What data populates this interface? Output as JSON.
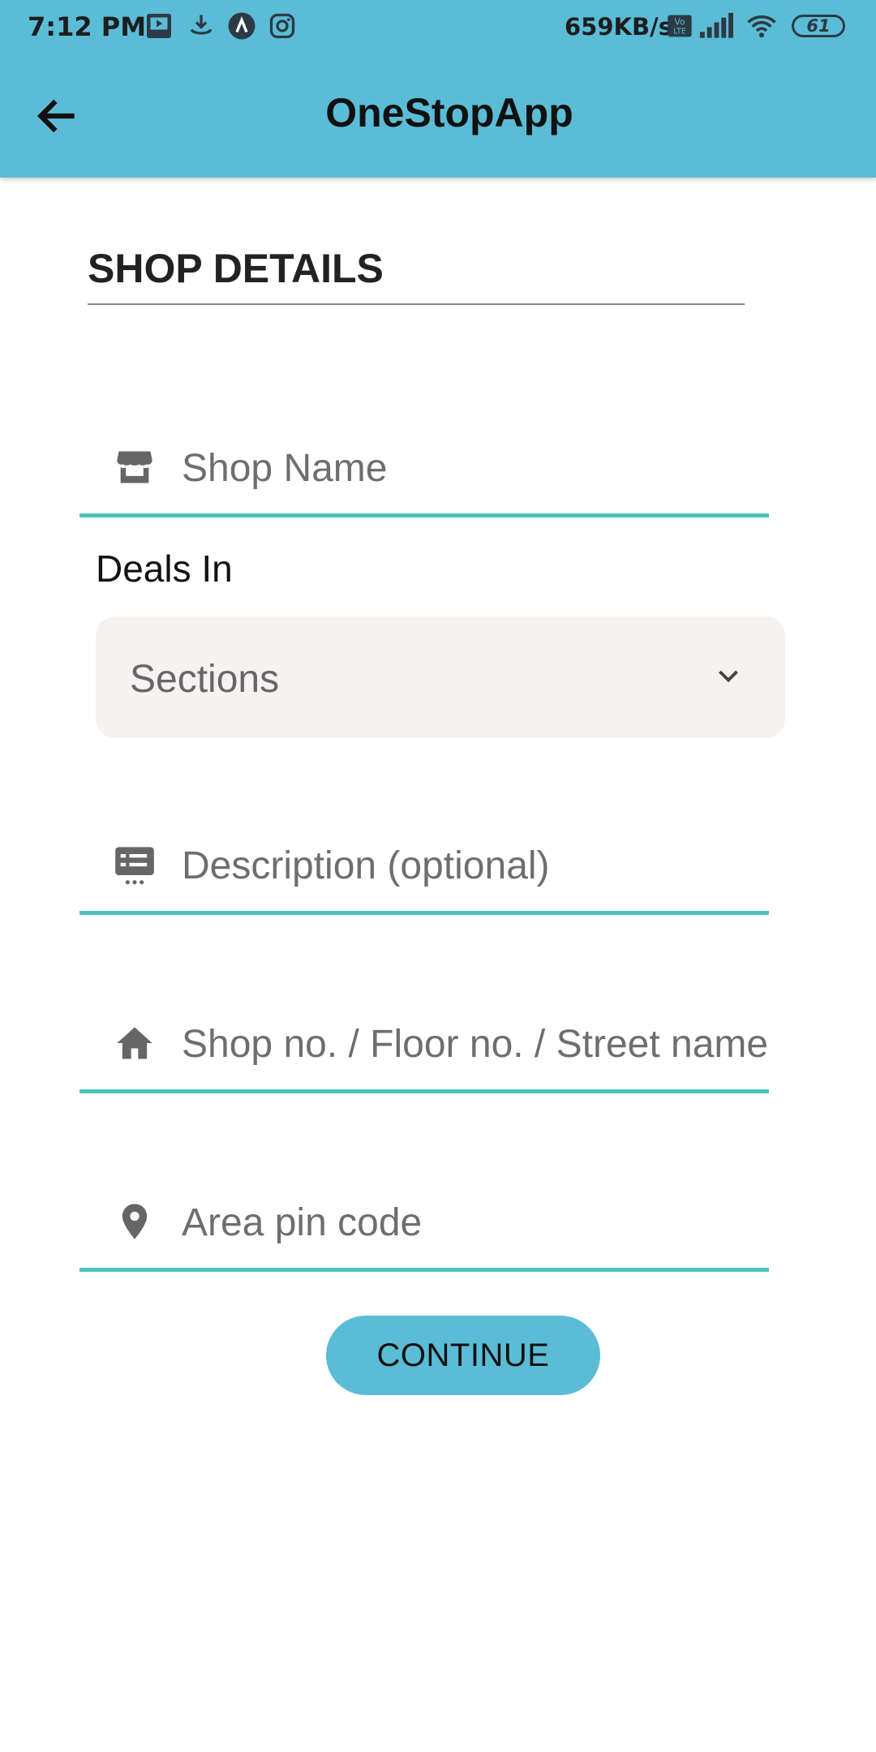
{
  "status_bar": {
    "time": "7:12 PM",
    "network_speed": "659KB/s",
    "battery": "61",
    "icons": [
      "media-icon",
      "download-icon",
      "app-icon",
      "instagram-icon",
      "volte-icon",
      "signal-icon",
      "wifi-icon",
      "battery-icon"
    ]
  },
  "app_bar": {
    "title": "OneStopApp",
    "back_icon": "arrow-back-icon"
  },
  "form": {
    "heading": "SHOP DETAILS",
    "shop_name": {
      "placeholder": "Shop Name",
      "icon": "store-icon"
    },
    "deals_in": {
      "label": "Deals In",
      "selected": "Sections",
      "icon": "chevron-down-icon"
    },
    "description": {
      "placeholder": "Description (optional)",
      "icon": "description-icon"
    },
    "address": {
      "placeholder": "Shop no. / Floor no. / Street name",
      "icon": "home-icon"
    },
    "pincode": {
      "placeholder": "Area pin code",
      "icon": "location-pin-icon"
    },
    "continue_label": "CONTINUE"
  },
  "colors": {
    "accent": "#5bbcd6",
    "underline": "#4fc2bd",
    "dropdown_bg": "#f6f2f1"
  }
}
